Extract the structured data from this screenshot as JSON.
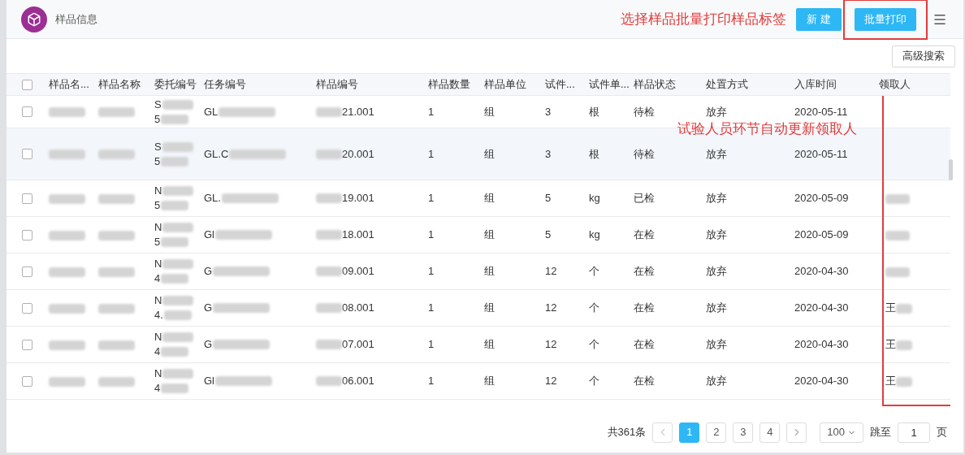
{
  "header": {
    "title": "样品信息",
    "buttons": [
      "新 建",
      "批量打印"
    ]
  },
  "annotations": [
    {
      "text": "选择样品批量打印样品标签"
    },
    {
      "text": "试验人员环节自动更新领取人"
    }
  ],
  "toolbar": {
    "advanced_search": "高级搜索"
  },
  "table": {
    "columns": [
      "样品名...",
      "样品名称",
      "委托编号",
      "任务编号",
      "样品编号",
      "样品数量",
      "样品单位",
      "试件...",
      "试件单...",
      "样品状态",
      "处置方式",
      "入库时间",
      "领取人"
    ],
    "header_checked": false,
    "rows": [
      {
        "checked": false,
        "highlighted": false,
        "entrust": [
          "S",
          "5"
        ],
        "task": "GL",
        "sample_no": "21.001",
        "qty": "1",
        "unit": "组",
        "pieces": "3",
        "piece_unit": "根",
        "status": "待检",
        "disposal": "放弃",
        "date": "2020-05-11",
        "receiver": "",
        "receiver_redacted": false
      },
      {
        "checked": false,
        "highlighted": true,
        "entrust": [
          "S",
          "5"
        ],
        "task": "GL.C",
        "sample_no": "20.001",
        "qty": "1",
        "unit": "组",
        "pieces": "3",
        "piece_unit": "根",
        "status": "待检",
        "disposal": "放弃",
        "date": "2020-05-11",
        "receiver": "",
        "receiver_redacted": false
      },
      {
        "checked": false,
        "highlighted": false,
        "entrust": [
          "N",
          "5"
        ],
        "task": "GL.",
        "sample_no": "19.001",
        "qty": "1",
        "unit": "组",
        "pieces": "5",
        "piece_unit": "kg",
        "status": "已检",
        "disposal": "放弃",
        "date": "2020-05-09",
        "receiver": "",
        "receiver_redacted": true
      },
      {
        "checked": false,
        "highlighted": false,
        "entrust": [
          "N",
          "5"
        ],
        "task": "Gl",
        "sample_no": "18.001",
        "qty": "1",
        "unit": "组",
        "pieces": "5",
        "piece_unit": "kg",
        "status": "在检",
        "disposal": "放弃",
        "date": "2020-05-09",
        "receiver": "",
        "receiver_redacted": true
      },
      {
        "checked": false,
        "highlighted": false,
        "entrust": [
          "N",
          "4"
        ],
        "task": "G",
        "sample_no": "09.001",
        "qty": "1",
        "unit": "组",
        "pieces": "12",
        "piece_unit": "个",
        "status": "在检",
        "disposal": "放弃",
        "date": "2020-04-30",
        "receiver": "",
        "receiver_redacted": true
      },
      {
        "checked": false,
        "highlighted": false,
        "entrust": [
          "N",
          "4."
        ],
        "task": "G",
        "sample_no": "08.001",
        "qty": "1",
        "unit": "组",
        "pieces": "12",
        "piece_unit": "个",
        "status": "在检",
        "disposal": "放弃",
        "date": "2020-04-30",
        "receiver": "王",
        "receiver_redacted": true
      },
      {
        "checked": false,
        "highlighted": false,
        "entrust": [
          "N",
          "4"
        ],
        "task": "G",
        "sample_no": "07.001",
        "qty": "1",
        "unit": "组",
        "pieces": "12",
        "piece_unit": "个",
        "status": "在检",
        "disposal": "放弃",
        "date": "2020-04-30",
        "receiver": "王",
        "receiver_redacted": true
      },
      {
        "checked": false,
        "highlighted": false,
        "entrust": [
          "N",
          "4"
        ],
        "task": "Gl",
        "sample_no": "06.001",
        "qty": "1",
        "unit": "组",
        "pieces": "12",
        "piece_unit": "个",
        "status": "在检",
        "disposal": "放弃",
        "date": "2020-04-30",
        "receiver": "王",
        "receiver_redacted": true
      }
    ]
  },
  "pagination": {
    "total": "共361条",
    "pages": [
      {
        "label": "1",
        "selected": true
      },
      {
        "label": "2",
        "selected": false
      },
      {
        "label": "3",
        "selected": false
      },
      {
        "label": "4",
        "selected": false
      }
    ],
    "page_size": "100",
    "jump_label": "跳至",
    "jump_value": "1",
    "jump_suffix": "页"
  }
}
